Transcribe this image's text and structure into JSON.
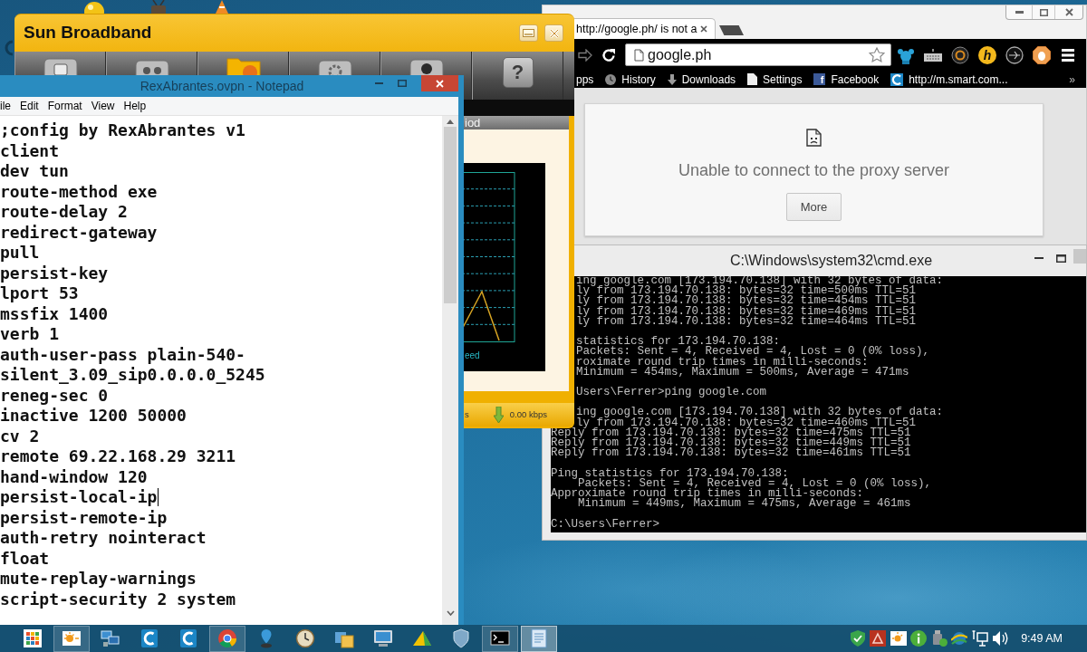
{
  "sun_broadband": {
    "title": "Sun Broadband",
    "help_glyph": "?",
    "panel_header": "iod",
    "graph_legend": "eed",
    "status_text": "s",
    "download_speed": "0.00 kbps"
  },
  "notepad": {
    "title": "RexAbrantes.ovpn - Notepad",
    "menu": [
      "ile",
      "Edit",
      "Format",
      "View",
      "Help"
    ],
    "lines": [
      {
        "text": ";config by RexAbrantes v1",
        "caret": false
      },
      {
        "text": "client",
        "caret": false
      },
      {
        "text": "dev tun",
        "caret": false
      },
      {
        "text": "route-method exe",
        "caret": false
      },
      {
        "text": "route-delay 2",
        "caret": false
      },
      {
        "text": "redirect-gateway",
        "caret": false
      },
      {
        "text": "pull",
        "caret": false
      },
      {
        "text": "persist-key",
        "caret": false
      },
      {
        "text": "lport 53",
        "caret": false
      },
      {
        "text": "mssfix 1400",
        "caret": false
      },
      {
        "text": "verb 1",
        "caret": false
      },
      {
        "text": "auth-user-pass plain-540-",
        "caret": false
      },
      {
        "text": "silent_3.09_sip0.0.0.0_5245",
        "caret": false
      },
      {
        "text": "reneg-sec 0",
        "caret": false
      },
      {
        "text": "inactive 1200 50000",
        "caret": false
      },
      {
        "text": "cv 2",
        "caret": false
      },
      {
        "text": "remote 69.22.168.29 3211",
        "caret": false
      },
      {
        "text": "hand-window 120",
        "caret": false
      },
      {
        "text": "persist-local-ip",
        "caret": true
      },
      {
        "text": "persist-remote-ip",
        "caret": false
      },
      {
        "text": "auth-retry nointeract",
        "caret": false
      },
      {
        "text": "float",
        "caret": false
      },
      {
        "text": "mute-replay-warnings",
        "caret": false
      },
      {
        "text": "script-security 2 system",
        "caret": false
      }
    ]
  },
  "chrome": {
    "tab_title": "http://google.ph/ is not a",
    "address": "google.ph",
    "extension_letter": "h",
    "bookmarks": [
      {
        "kind": "plain",
        "label": "pps"
      },
      {
        "kind": "clock",
        "label": "History"
      },
      {
        "kind": "download",
        "label": "Downloads"
      },
      {
        "kind": "page",
        "label": "Settings"
      },
      {
        "kind": "letter",
        "icon_text": "f",
        "label": "Facebook"
      },
      {
        "kind": "crescent",
        "label": "http://m.smart.com..."
      }
    ],
    "bookmarks_overflow": "»",
    "error_message": "Unable to connect to the proxy server",
    "error_button": "More"
  },
  "cmd": {
    "title": "C:\\Windows\\system32\\cmd.exe",
    "lines": [
      {
        "kind": "clipped",
        "text": "ing google.com [173.194.70.138] with 32 bytes of data:"
      },
      {
        "kind": "clipped",
        "text": "ly from 173.194.70.138: bytes=32 time=500ms TTL=51"
      },
      {
        "kind": "clipped",
        "text": "ly from 173.194.70.138: bytes=32 time=454ms TTL=51"
      },
      {
        "kind": "clipped",
        "text": "ly from 173.194.70.138: bytes=32 time=469ms TTL=51"
      },
      {
        "kind": "clipped",
        "text": "ly from 173.194.70.138: bytes=32 time=464ms TTL=51"
      },
      {
        "kind": "blank"
      },
      {
        "kind": "clipped",
        "text": "statistics for 173.194.70.138:"
      },
      {
        "kind": "clipped",
        "text": "Packets: Sent = 4, Received = 4, Lost = 0 (0% loss),"
      },
      {
        "kind": "clipped",
        "text": "roximate round trip times in milli-seconds:"
      },
      {
        "kind": "clipped",
        "text": "Minimum = 454ms, Maximum = 500ms, Average = 471ms"
      },
      {
        "kind": "blank"
      },
      {
        "kind": "clipped",
        "text": "Users\\Ferrer>ping google.com"
      },
      {
        "kind": "blank"
      },
      {
        "kind": "clipped",
        "text": "ing google.com [173.194.70.138] with 32 bytes of data:"
      },
      {
        "kind": "clipped",
        "text": "ly from 173.194.70.138: bytes=32 time=460ms TTL=51"
      },
      {
        "kind": "full",
        "text": "Reply from 173.194.70.138: bytes=32 time=475ms TTL=51"
      },
      {
        "kind": "full",
        "text": "Reply from 173.194.70.138: bytes=32 time=449ms TTL=51"
      },
      {
        "kind": "full",
        "text": "Reply from 173.194.70.138: bytes=32 time=461ms TTL=51"
      },
      {
        "kind": "blank"
      },
      {
        "kind": "full",
        "text": "Ping statistics for 173.194.70.138:"
      },
      {
        "kind": "indented",
        "text": "Packets: Sent = 4, Received = 4, Lost = 0 (0% loss),"
      },
      {
        "kind": "full",
        "text": "Approximate round trip times in milli-seconds:"
      },
      {
        "kind": "indented",
        "text": "Minimum = 449ms, Maximum = 475ms, Average = 461ms"
      },
      {
        "kind": "blank"
      },
      {
        "kind": "full",
        "text": "C:\\Users\\Ferrer>"
      }
    ]
  },
  "taskbar": {
    "apps": [
      {
        "kind": "tiles",
        "running": false,
        "selected": false
      },
      {
        "kind": "sun",
        "running": true,
        "selected": false
      },
      {
        "kind": "network",
        "running": false,
        "selected": false
      },
      {
        "kind": "crescent",
        "running": false,
        "selected": false
      },
      {
        "kind": "crescent",
        "running": false,
        "selected": false
      },
      {
        "kind": "browser",
        "running": true,
        "selected": false
      },
      {
        "kind": "pin",
        "running": false,
        "selected": false
      },
      {
        "kind": "clock",
        "running": false,
        "selected": false
      },
      {
        "kind": "cards",
        "running": false,
        "selected": false
      },
      {
        "kind": "monitor",
        "running": false,
        "selected": false
      },
      {
        "kind": "triangle",
        "running": false,
        "selected": false
      },
      {
        "kind": "shield",
        "running": false,
        "selected": false
      },
      {
        "kind": "console",
        "running": true,
        "selected": false
      },
      {
        "kind": "notepad",
        "running": true,
        "selected": true
      }
    ],
    "clock": "9:49 AM"
  }
}
